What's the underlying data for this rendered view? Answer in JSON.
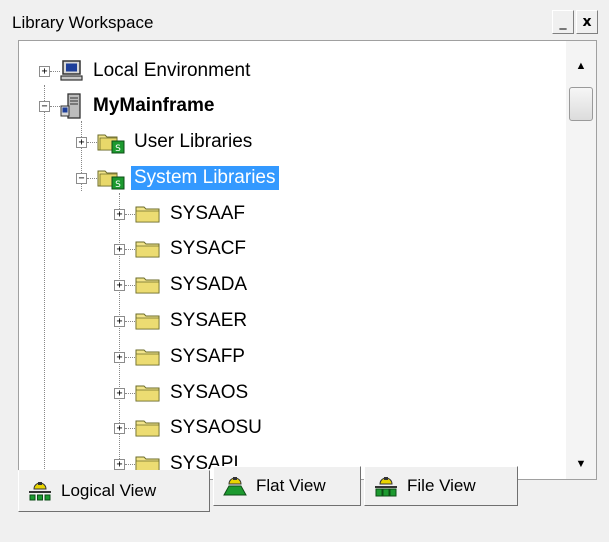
{
  "window": {
    "title": "Library Workspace",
    "minimize_label": "_",
    "close_label": "x"
  },
  "tree": {
    "nodes": [
      {
        "label": "Local Environment",
        "expander": "+",
        "icon": "computer-icon"
      },
      {
        "label": "MyMainframe",
        "expander": "−",
        "icon": "server-icon"
      },
      {
        "label": "User Libraries",
        "expander": "+",
        "icon": "library-folder-icon"
      },
      {
        "label": "System Libraries",
        "expander": "−",
        "icon": "library-folder-icon",
        "selected": true
      },
      {
        "label": "SYSAAF",
        "expander": "+",
        "icon": "folder-icon"
      },
      {
        "label": "SYSACF",
        "expander": "+",
        "icon": "folder-icon"
      },
      {
        "label": "SYSADA",
        "expander": "+",
        "icon": "folder-icon"
      },
      {
        "label": "SYSAER",
        "expander": "+",
        "icon": "folder-icon"
      },
      {
        "label": "SYSAFP",
        "expander": "+",
        "icon": "folder-icon"
      },
      {
        "label": "SYSAOS",
        "expander": "+",
        "icon": "folder-icon"
      },
      {
        "label": "SYSAOSU",
        "expander": "+",
        "icon": "folder-icon"
      },
      {
        "label": "SYSAPI",
        "expander": "+",
        "icon": "folder-icon"
      }
    ]
  },
  "tabs": [
    {
      "label": "Logical View",
      "active": true,
      "icon": "logical-view-icon"
    },
    {
      "label": "Flat View",
      "active": false,
      "icon": "flat-view-icon"
    },
    {
      "label": "File View",
      "active": false,
      "icon": "file-view-icon"
    }
  ],
  "colors": {
    "selection": "#3399ff",
    "folder": "#f2e48a",
    "library_badge": "#1c9a2f"
  }
}
